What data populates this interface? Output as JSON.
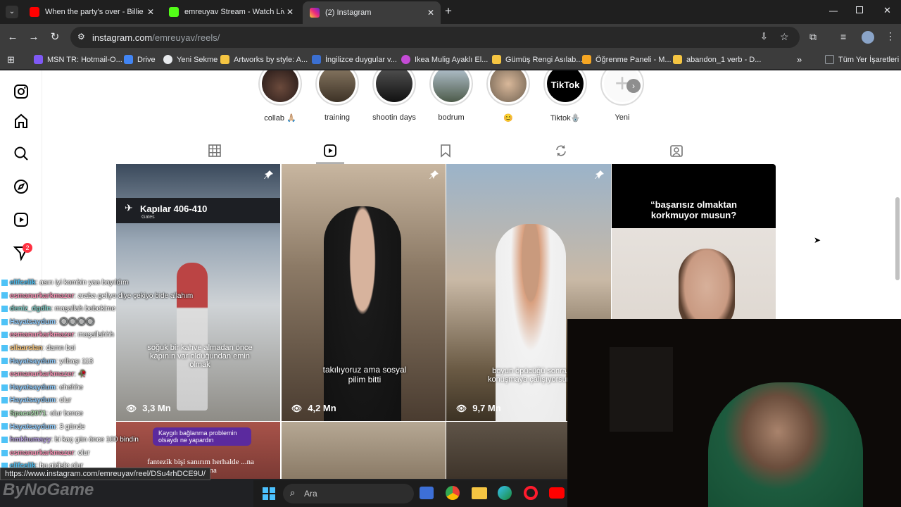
{
  "tabs": [
    {
      "title": "When the party's over - Billie Ei",
      "color": "#ff0000"
    },
    {
      "title": "emreuyav Stream - Watch Live o",
      "color": "#53fc18"
    },
    {
      "title": "(2) Instagram",
      "color": "#d62976"
    }
  ],
  "toolbar": {
    "url_main": "instagram.com",
    "url_path": "/emreuyav/reels/"
  },
  "bookmarks": [
    {
      "label": "MSN TR: Hotmail-O...",
      "color": "#7f59f5"
    },
    {
      "label": "Drive",
      "color": "#4285f4"
    },
    {
      "label": "Yeni Sekme",
      "color": "#e8eaed"
    },
    {
      "label": "Artworks by style: A...",
      "color": "#f5c542"
    },
    {
      "label": "İngilizce duygular v...",
      "color": "#3b6fd1"
    },
    {
      "label": "Ikea Mulig Ayaklı El...",
      "color": "#c44bd6"
    },
    {
      "label": "Gümüş Rengi Asılab...",
      "color": "#f5c542"
    },
    {
      "label": "Öğrenme Paneli - M...",
      "color": "#f5a623"
    },
    {
      "label": "abandon_1 verb - D...",
      "color": "#f5c542"
    },
    {
      "label": "Tüm Yer İşaretleri",
      "color": "#9aa0a6"
    }
  ],
  "stories": [
    {
      "label": "collab 🙏🏼",
      "color": "#3a2b2b"
    },
    {
      "label": "training",
      "color": "#5b4a36"
    },
    {
      "label": "shootin days",
      "color": "#2a2a2a"
    },
    {
      "label": "bodrum",
      "color": "#7b8c9e"
    },
    {
      "label": "😊",
      "color": "#9a8870"
    },
    {
      "label": "Tiktok🪬",
      "color": "#000000"
    },
    {
      "label": "Yeni",
      "color": "#ffffff"
    }
  ],
  "story_tiktok_text": "TikTok",
  "notification_badge": "2",
  "reels": [
    {
      "views": "3,3 Mn",
      "caption": "soğuk bir kahve almadan önce kapının var olduğundan emin olmak",
      "sign": "Kapılar 406-410",
      "sign_sub": "Gates"
    },
    {
      "views": "4,2 Mn",
      "caption": "takılıyoruz ama sosyal pilim bitti"
    },
    {
      "views": "9,7 Mn",
      "caption": "boyun öpücüğü sonra konuşmaya çalışıyorsun"
    },
    {
      "views": "",
      "caption": "“başarısız olmaktan korkmuyor musun?"
    }
  ],
  "reel_row2": {
    "bubble": "Kaygılı bağlanma problemin olsaydı ne yapardın",
    "caption": "fantezik bişi sanırım herhalde ...na mağlanma"
  },
  "chat": [
    {
      "name": "elifcelik",
      "msg": ": asırı iyi kombin yaa bayıldım",
      "color": "#4fc3f7"
    },
    {
      "name": "esmanurkarkmazer",
      "msg": ": araba geliyo diye çekiyo bide allahım",
      "color": "#f48fb1"
    },
    {
      "name": "deniz_dgdln",
      "msg": ": maşallah bebekime",
      "color": "#80cbc4"
    },
    {
      "name": "Hayatsaydum",
      "msg": ": 🔘🔘🔘🔘",
      "color": "#90caf9"
    },
    {
      "name": "esmanurkarkmazer",
      "msg": ": maşallahhh",
      "color": "#f48fb1"
    },
    {
      "name": "silaarslan",
      "msg": ": damn boi",
      "color": "#ffcc80"
    },
    {
      "name": "Hayatsaydum",
      "msg": ": yılbaşı 113",
      "color": "#90caf9"
    },
    {
      "name": "esmanurkarkmazer",
      "msg": ": 🥀",
      "color": "#f48fb1"
    },
    {
      "name": "Hayatsaydum",
      "msg": ": ehehhe",
      "color": "#90caf9"
    },
    {
      "name": "Hayatsaydum",
      "msg": ": olur",
      "color": "#90caf9"
    },
    {
      "name": "Space2071",
      "msg": ": olur bence",
      "color": "#a5d6a7"
    },
    {
      "name": "Hayatsaydum",
      "msg": ": 3 günde",
      "color": "#90caf9"
    },
    {
      "name": "hmkhumayy",
      "msg": ": bi kaç gün önce 100 bindin",
      "color": "#b39ddb"
    },
    {
      "name": "esmanurkarkmazer",
      "msg": ": olur",
      "color": "#f48fb1"
    },
    {
      "name": "elifcelik",
      "msg": ": bu gidişle olur",
      "color": "#4fc3f7"
    }
  ],
  "status_url": "https://www.instagram.com/emreuyav/reel/DSu4rhDCE9U/",
  "taskbar": {
    "search_placeholder": "Ara"
  },
  "watermark": "ByNoGame"
}
